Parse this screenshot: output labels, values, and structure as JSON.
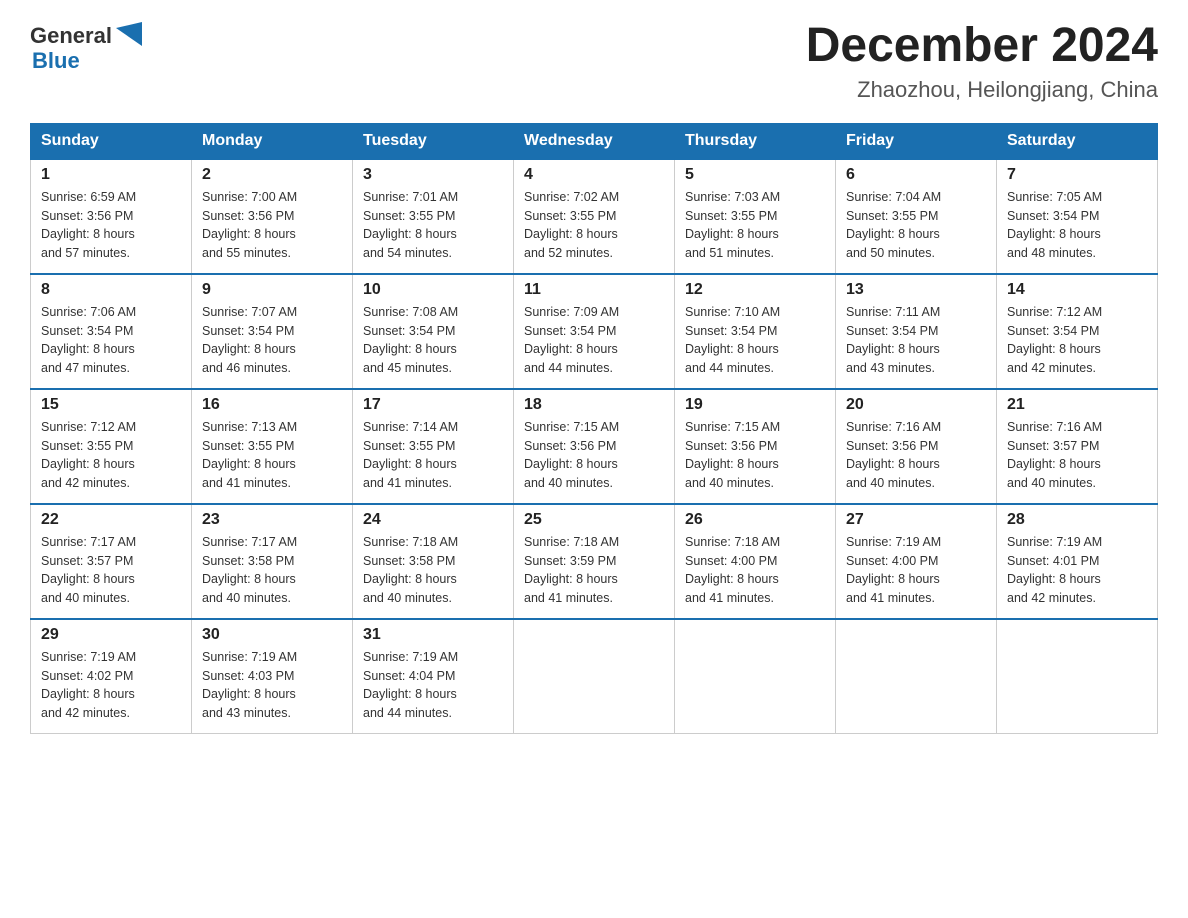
{
  "header": {
    "logo_general": "General",
    "logo_blue": "Blue",
    "month_title": "December 2024",
    "location": "Zhaozhou, Heilongjiang, China"
  },
  "days_of_week": [
    "Sunday",
    "Monday",
    "Tuesday",
    "Wednesday",
    "Thursday",
    "Friday",
    "Saturday"
  ],
  "weeks": [
    [
      {
        "day": "1",
        "sunrise": "6:59 AM",
        "sunset": "3:56 PM",
        "daylight": "8 hours and 57 minutes."
      },
      {
        "day": "2",
        "sunrise": "7:00 AM",
        "sunset": "3:56 PM",
        "daylight": "8 hours and 55 minutes."
      },
      {
        "day": "3",
        "sunrise": "7:01 AM",
        "sunset": "3:55 PM",
        "daylight": "8 hours and 54 minutes."
      },
      {
        "day": "4",
        "sunrise": "7:02 AM",
        "sunset": "3:55 PM",
        "daylight": "8 hours and 52 minutes."
      },
      {
        "day": "5",
        "sunrise": "7:03 AM",
        "sunset": "3:55 PM",
        "daylight": "8 hours and 51 minutes."
      },
      {
        "day": "6",
        "sunrise": "7:04 AM",
        "sunset": "3:55 PM",
        "daylight": "8 hours and 50 minutes."
      },
      {
        "day": "7",
        "sunrise": "7:05 AM",
        "sunset": "3:54 PM",
        "daylight": "8 hours and 48 minutes."
      }
    ],
    [
      {
        "day": "8",
        "sunrise": "7:06 AM",
        "sunset": "3:54 PM",
        "daylight": "8 hours and 47 minutes."
      },
      {
        "day": "9",
        "sunrise": "7:07 AM",
        "sunset": "3:54 PM",
        "daylight": "8 hours and 46 minutes."
      },
      {
        "day": "10",
        "sunrise": "7:08 AM",
        "sunset": "3:54 PM",
        "daylight": "8 hours and 45 minutes."
      },
      {
        "day": "11",
        "sunrise": "7:09 AM",
        "sunset": "3:54 PM",
        "daylight": "8 hours and 44 minutes."
      },
      {
        "day": "12",
        "sunrise": "7:10 AM",
        "sunset": "3:54 PM",
        "daylight": "8 hours and 44 minutes."
      },
      {
        "day": "13",
        "sunrise": "7:11 AM",
        "sunset": "3:54 PM",
        "daylight": "8 hours and 43 minutes."
      },
      {
        "day": "14",
        "sunrise": "7:12 AM",
        "sunset": "3:54 PM",
        "daylight": "8 hours and 42 minutes."
      }
    ],
    [
      {
        "day": "15",
        "sunrise": "7:12 AM",
        "sunset": "3:55 PM",
        "daylight": "8 hours and 42 minutes."
      },
      {
        "day": "16",
        "sunrise": "7:13 AM",
        "sunset": "3:55 PM",
        "daylight": "8 hours and 41 minutes."
      },
      {
        "day": "17",
        "sunrise": "7:14 AM",
        "sunset": "3:55 PM",
        "daylight": "8 hours and 41 minutes."
      },
      {
        "day": "18",
        "sunrise": "7:15 AM",
        "sunset": "3:56 PM",
        "daylight": "8 hours and 40 minutes."
      },
      {
        "day": "19",
        "sunrise": "7:15 AM",
        "sunset": "3:56 PM",
        "daylight": "8 hours and 40 minutes."
      },
      {
        "day": "20",
        "sunrise": "7:16 AM",
        "sunset": "3:56 PM",
        "daylight": "8 hours and 40 minutes."
      },
      {
        "day": "21",
        "sunrise": "7:16 AM",
        "sunset": "3:57 PM",
        "daylight": "8 hours and 40 minutes."
      }
    ],
    [
      {
        "day": "22",
        "sunrise": "7:17 AM",
        "sunset": "3:57 PM",
        "daylight": "8 hours and 40 minutes."
      },
      {
        "day": "23",
        "sunrise": "7:17 AM",
        "sunset": "3:58 PM",
        "daylight": "8 hours and 40 minutes."
      },
      {
        "day": "24",
        "sunrise": "7:18 AM",
        "sunset": "3:58 PM",
        "daylight": "8 hours and 40 minutes."
      },
      {
        "day": "25",
        "sunrise": "7:18 AM",
        "sunset": "3:59 PM",
        "daylight": "8 hours and 41 minutes."
      },
      {
        "day": "26",
        "sunrise": "7:18 AM",
        "sunset": "4:00 PM",
        "daylight": "8 hours and 41 minutes."
      },
      {
        "day": "27",
        "sunrise": "7:19 AM",
        "sunset": "4:00 PM",
        "daylight": "8 hours and 41 minutes."
      },
      {
        "day": "28",
        "sunrise": "7:19 AM",
        "sunset": "4:01 PM",
        "daylight": "8 hours and 42 minutes."
      }
    ],
    [
      {
        "day": "29",
        "sunrise": "7:19 AM",
        "sunset": "4:02 PM",
        "daylight": "8 hours and 42 minutes."
      },
      {
        "day": "30",
        "sunrise": "7:19 AM",
        "sunset": "4:03 PM",
        "daylight": "8 hours and 43 minutes."
      },
      {
        "day": "31",
        "sunrise": "7:19 AM",
        "sunset": "4:04 PM",
        "daylight": "8 hours and 44 minutes."
      },
      null,
      null,
      null,
      null
    ]
  ],
  "labels": {
    "sunrise": "Sunrise:",
    "sunset": "Sunset:",
    "daylight": "Daylight:"
  }
}
